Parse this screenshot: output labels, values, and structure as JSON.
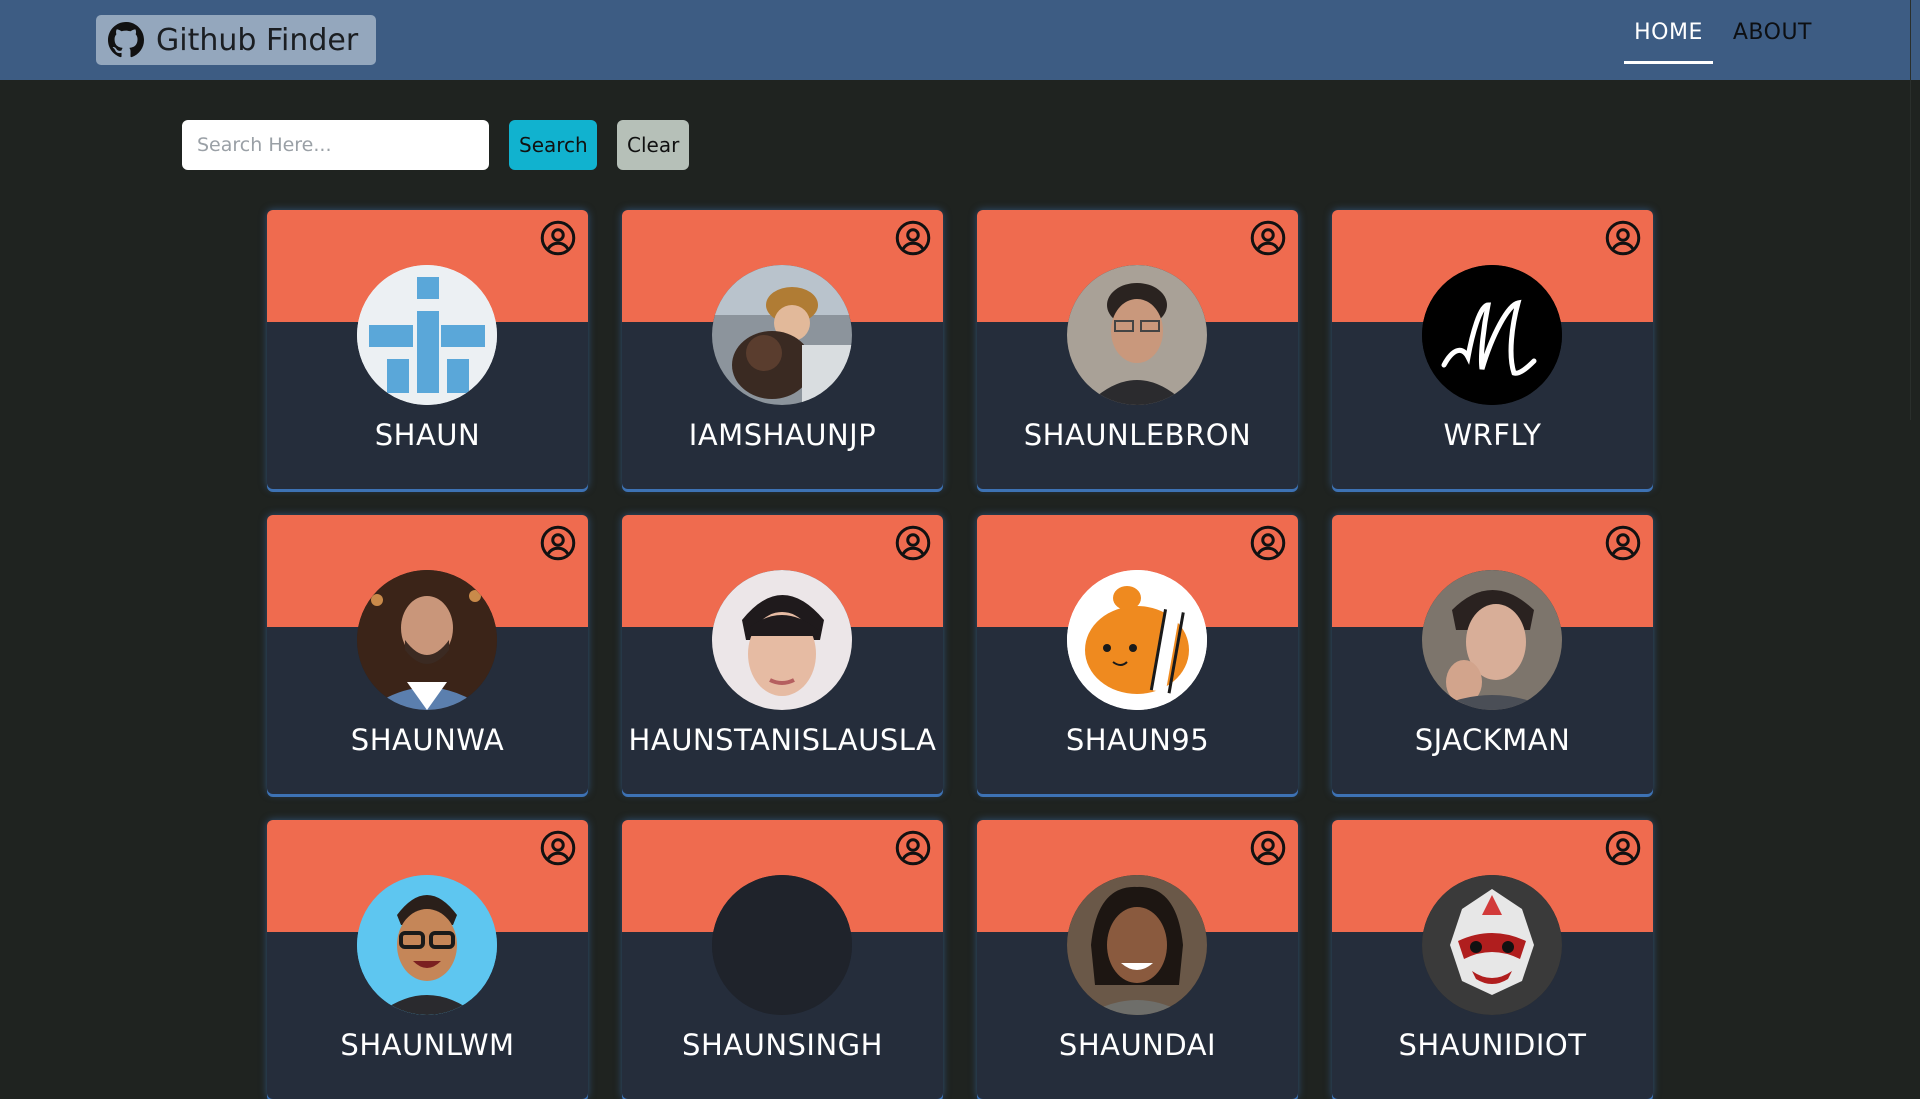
{
  "navbar": {
    "brand": "Github Finder",
    "links": [
      {
        "label": "HOME",
        "active": true
      },
      {
        "label": "ABOUT",
        "active": false
      }
    ]
  },
  "search": {
    "placeholder": "Search Here...",
    "value": "",
    "search_label": "Search",
    "clear_label": "Clear"
  },
  "users": [
    {
      "login": "SHAUN",
      "avatar": "blue-cross-identicon"
    },
    {
      "login": "IAMSHAUNJP",
      "avatar": "man-with-dog-photo"
    },
    {
      "login": "SHAUNLEBRON",
      "avatar": "man-with-glasses-photo"
    },
    {
      "login": "WRFLY",
      "avatar": "script-m-logo"
    },
    {
      "login": "SHAUNWA",
      "avatar": "smiling-man-plaid-photo"
    },
    {
      "login": "HAUNSTANISLAUSLA",
      "avatar": "young-man-photo"
    },
    {
      "login": "SHAUN95",
      "avatar": "clownfish-plush"
    },
    {
      "login": "SJACKMAN",
      "avatar": "man-hand-on-face-photo"
    },
    {
      "login": "SHAUNLWM",
      "avatar": "cartoon-man-glasses"
    },
    {
      "login": "SHAUNSINGH",
      "avatar": "blank-dark-avatar"
    },
    {
      "login": "SHAUNDAI",
      "avatar": "smiling-woman-photo"
    },
    {
      "login": "SHAUNIDIOT",
      "avatar": "masked-creature-art"
    }
  ],
  "colors": {
    "navbar": "#3d5c83",
    "background": "#1f2320",
    "card_top": "#ef6b4f",
    "card_bottom": "#252d3b",
    "search_button": "#11b2cf",
    "clear_button": "#b6c0b8"
  }
}
